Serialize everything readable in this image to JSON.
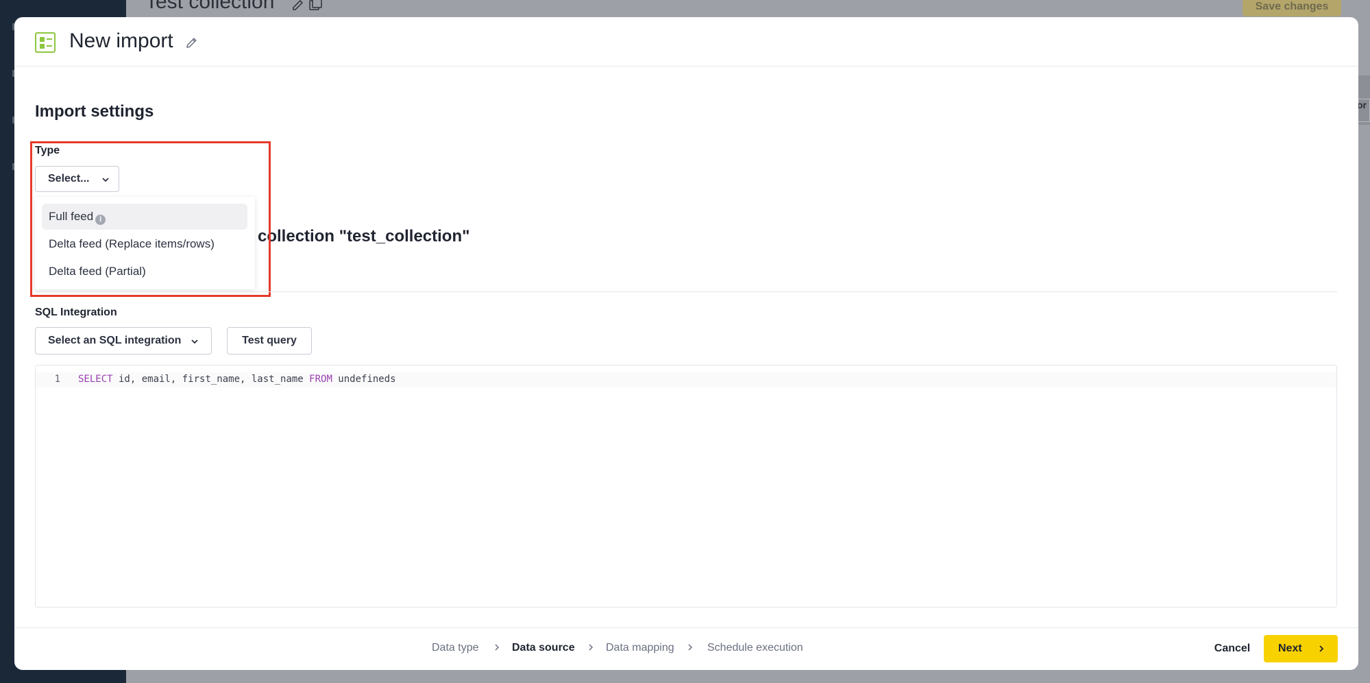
{
  "background": {
    "page_title": "Test collection",
    "save_button": "Save changes",
    "right_tab_fragment": "or"
  },
  "modal": {
    "title": "New import",
    "section_title": "Import settings",
    "type_field": {
      "label": "Type",
      "selected": "Select...",
      "options": [
        {
          "label": "Full feed",
          "has_info": true,
          "highlighted": true
        },
        {
          "label": "Delta feed (Replace items/rows)"
        },
        {
          "label": "Delta feed (Partial)"
        }
      ]
    },
    "collection_heading": "collection \"test_collection\"",
    "sql_integration": {
      "label": "SQL Integration",
      "select_placeholder": "Select an SQL integration",
      "test_button": "Test query"
    },
    "editor": {
      "line_number": "1",
      "kw_select": "SELECT",
      "columns": " id, email, first_name, last_name ",
      "kw_from": "FROM",
      "table": " undefineds"
    }
  },
  "footer": {
    "steps": [
      "Data type",
      "Data source",
      "Data mapping",
      "Schedule execution"
    ],
    "current_step": "Data source",
    "cancel": "Cancel",
    "next": "Next"
  },
  "colors": {
    "accent": "#f8d100",
    "highlight_border": "#e53a2a",
    "icon_green": "#8dc63f",
    "keyword": "#9a3fb0"
  }
}
